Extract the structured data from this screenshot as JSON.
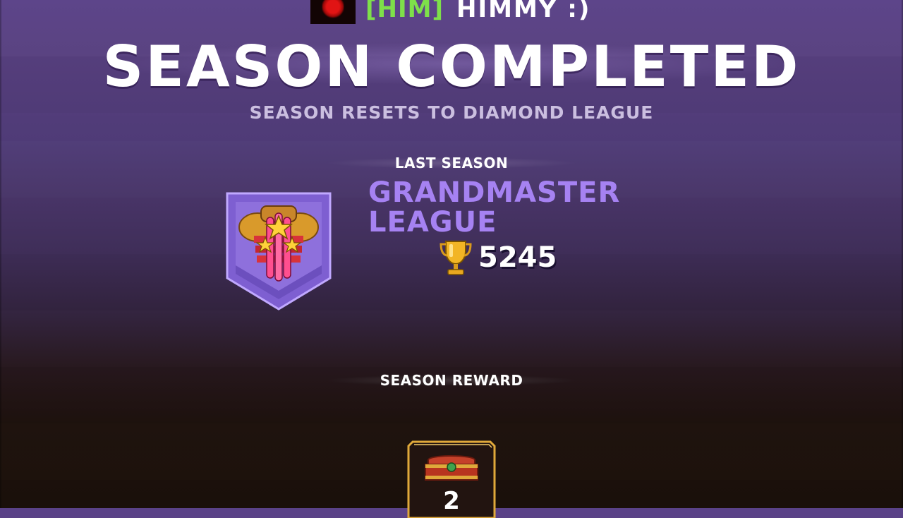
{
  "player": {
    "clan_tag": "[HIM]",
    "name": "HIMMY :)"
  },
  "header": {
    "title": "SEASON COMPLETED",
    "subtitle": "SEASON RESETS TO DIAMOND LEAGUE"
  },
  "last_season": {
    "label": "LAST SEASON",
    "league_line1": "GRANDMASTER",
    "league_line2": "LEAGUE",
    "trophies": "5245"
  },
  "reward": {
    "label": "SEASON REWARD",
    "count": "2"
  },
  "colors": {
    "league_text": "#a682f2",
    "clan_tag": "#7ee04a",
    "badge_frame": "#b69cf3",
    "reward_frame": "#e0a93a"
  }
}
